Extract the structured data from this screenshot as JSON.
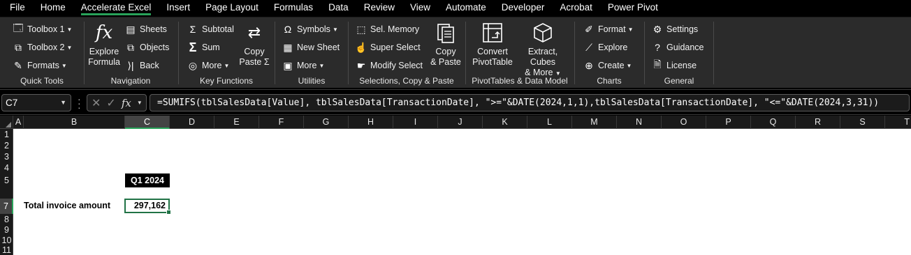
{
  "tabs": [
    "File",
    "Home",
    "Accelerate Excel",
    "Insert",
    "Page Layout",
    "Formulas",
    "Data",
    "Review",
    "View",
    "Automate",
    "Developer",
    "Acrobat",
    "Power Pivot"
  ],
  "active_tab": "Accelerate Excel",
  "ribbon": {
    "quick_tools": {
      "label": "Quick Tools",
      "toolbox1": "Toolbox 1",
      "toolbox2": "Toolbox 2",
      "formats": "Formats"
    },
    "navigation": {
      "label": "Navigation",
      "explore_formula_1": "Explore",
      "explore_formula_2": "Formula",
      "sheets": "Sheets",
      "objects": "Objects",
      "back": "Back"
    },
    "key_functions": {
      "label": "Key Functions",
      "subtotal": "Subtotal",
      "sum": "Sum",
      "more": "More",
      "copy_paste_1": "Copy",
      "copy_paste_2": "Paste Σ"
    },
    "utilities": {
      "label": "Utilities",
      "symbols": "Symbols",
      "new_sheet": "New Sheet",
      "more": "More"
    },
    "selections": {
      "label": "Selections, Copy & Paste",
      "sel_memory": "Sel. Memory",
      "super_select": "Super Select",
      "modify_select": "Modify Select",
      "copy_paste_1": "Copy",
      "copy_paste_2": "& Paste"
    },
    "pivot": {
      "label": "PivotTables & Data Model",
      "convert_1": "Convert",
      "convert_2": "PivotTable",
      "extract_1": "Extract, Cubes",
      "extract_2": "& More"
    },
    "charts": {
      "label": "Charts",
      "format": "Format",
      "explore": "Explore",
      "create": "Create"
    },
    "general": {
      "label": "General",
      "settings": "Settings",
      "guidance": "Guidance",
      "license": "License"
    }
  },
  "formula_bar": {
    "name_box": "C7",
    "formula": "=SUMIFS(tblSalesData[Value], tblSalesData[TransactionDate], \">=\"&DATE(2024,1,1),tblSalesData[TransactionDate], \"<=\"&DATE(2024,3,31))"
  },
  "grid": {
    "columns": [
      "A",
      "B",
      "C",
      "D",
      "E",
      "F",
      "G",
      "H",
      "I",
      "J",
      "K",
      "L",
      "M",
      "N",
      "O",
      "P",
      "Q",
      "R",
      "S",
      "T"
    ],
    "rows": [
      "1",
      "2",
      "3",
      "4",
      "5",
      "7",
      "8",
      "9",
      "10",
      "11"
    ],
    "selected_column": "C",
    "selected_row": "7"
  },
  "cells": {
    "C5": "Q1 2024",
    "B7": "Total invoice amount",
    "C7": "297,162"
  },
  "colors": {
    "accent": "#29a35a",
    "selection_border": "#217346"
  }
}
